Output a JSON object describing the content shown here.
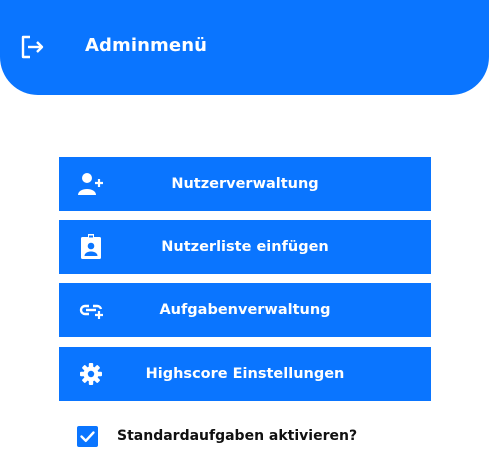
{
  "header": {
    "title": "Adminmenü",
    "logout_icon": "logout-icon"
  },
  "menu": {
    "buttons": [
      {
        "label": "Nutzerverwaltung",
        "icon": "add-user-icon"
      },
      {
        "label": "Nutzerliste einfügen",
        "icon": "id-badge-icon"
      },
      {
        "label": "Aufgabenverwaltung",
        "icon": "add-task-icon"
      },
      {
        "label": "Highscore Einstellungen",
        "icon": "gear-icon"
      }
    ]
  },
  "options": {
    "standard_tasks_label": "Standardaufgaben aktivieren?",
    "standard_tasks_checked": true
  },
  "colors": {
    "accent": "#0a75ff",
    "text_on_accent": "#ffffff"
  }
}
